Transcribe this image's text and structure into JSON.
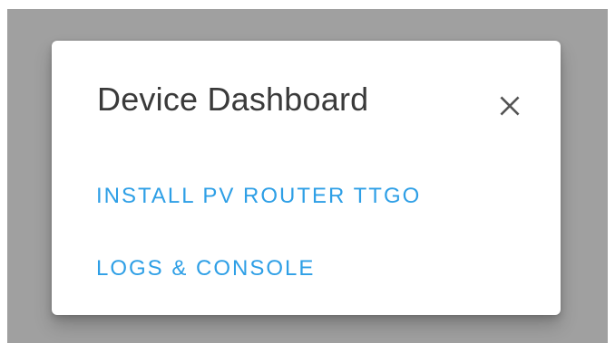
{
  "dialog": {
    "title": "Device Dashboard",
    "close_icon": "close-icon",
    "actions": [
      {
        "label": "INSTALL PV ROUTER TTGO"
      },
      {
        "label": "LOGS & CONSOLE"
      }
    ]
  },
  "colors": {
    "backdrop": "#a0a0a0",
    "dialog_background": "#ffffff",
    "title_text": "#3a3a3a",
    "action_text": "#2e9fe6",
    "close_icon": "#555555"
  }
}
